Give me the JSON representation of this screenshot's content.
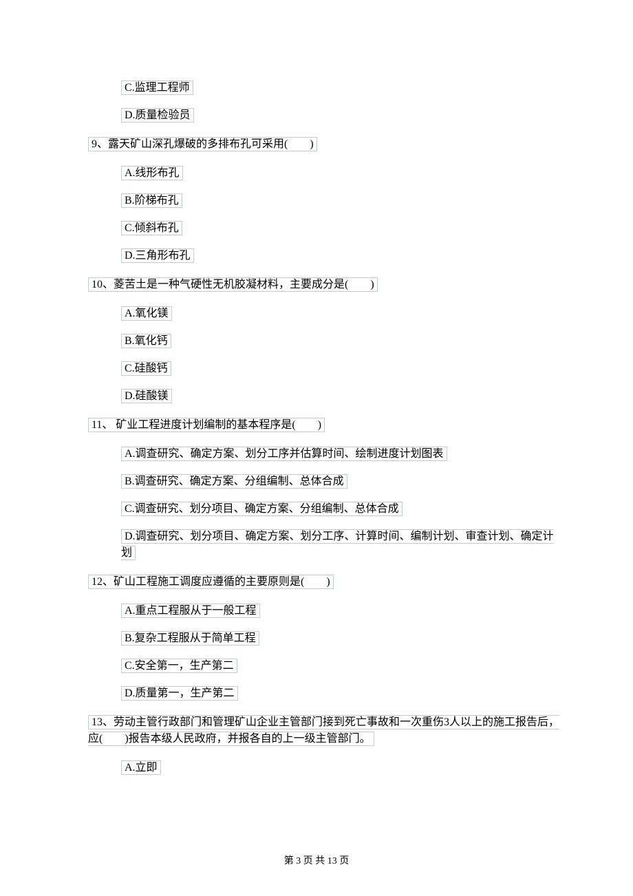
{
  "q8": {
    "optC": "C.监理工程师",
    "optD": "D.质量检验员"
  },
  "q9": {
    "stem": "9、露天矿山深孔爆破的多排布孔可采用(　　)",
    "optA": "A.线形布孔",
    "optB": "B.阶梯布孔",
    "optC": "C.倾斜布孔",
    "optD": "D.三角形布孔"
  },
  "q10": {
    "stem": "10、菱苦土是一种气硬性无机胶凝材料，主要成分是(　　)",
    "optA": "A.氧化镁",
    "optB": "B.氧化钙",
    "optC": "C.硅酸钙",
    "optD": "D.硅酸镁"
  },
  "q11": {
    "stem": "11、 矿业工程进度计划编制的基本程序是(　　)",
    "optA": "A.调查研究、确定方案、划分工序并估算时间、绘制进度计划图表",
    "optB": "B.调查研究、确定方案、分组编制、总体合成",
    "optC": "C.调查研究、划分项目、确定方案、分组编制、总体合成",
    "optD": "D.调查研究、划分项目、确定方案、划分工序、计算时间、编制计划、审查计划、确定计划"
  },
  "q12": {
    "stem": "12、矿山工程施工调度应遵循的主要原则是(　　)",
    "optA": "A.重点工程服从于一般工程",
    "optB": "B.复杂工程服从于简单工程",
    "optC": "C.安全第一，生产第二",
    "optD": "D.质量第一，生产第二"
  },
  "q13": {
    "stem": "13、劳动主管行政部门和管理矿山企业主管部门接到死亡事故和一次重伤3人以上的施工报告后，应(　　)报告本级人民政府，并报各自的上一级主管部门。",
    "optA": "A.立即"
  },
  "footer": "第 3 页 共 13 页"
}
